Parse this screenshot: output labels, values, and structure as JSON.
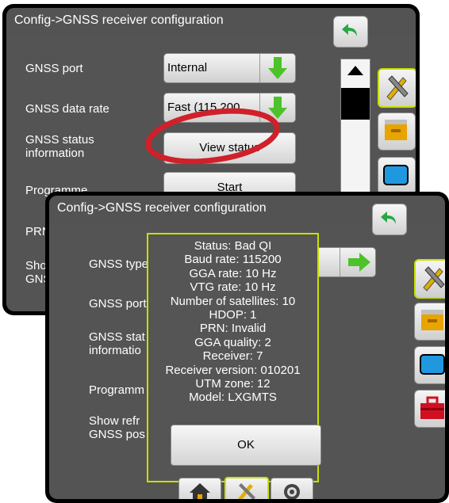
{
  "back_screen": {
    "title": "Config->GNSS receiver configuration",
    "rows": [
      {
        "label": "GNSS port",
        "value": "Internal"
      },
      {
        "label": "GNSS data rate",
        "value": "Fast (115 200"
      },
      {
        "label": "GNSS status\ninformation",
        "button": "View status"
      },
      {
        "label": "Programme",
        "button": "Start"
      },
      {
        "label": "PRN"
      },
      {
        "label": "Show\nGNSS"
      }
    ]
  },
  "front_screen": {
    "title": "Config->GNSS receiver configuration",
    "rows": [
      {
        "label": "GNSS type"
      },
      {
        "label": "GNSS port"
      },
      {
        "label": "GNSS stat\ninformatio"
      },
      {
        "label": "Programm"
      },
      {
        "label": "Show refr\nGNSS pos"
      }
    ]
  },
  "status_popup": {
    "lines": [
      "Status: Bad QI",
      "Baud rate: 115200",
      "GGA rate: 10 Hz",
      "VTG rate: 10 Hz",
      "Number of satellites: 10",
      "HDOP: 1",
      "PRN: Invalid",
      "GGA quality: 2",
      "Receiver: 7",
      "Receiver version: 010201",
      "UTM zone: 12",
      "Model: LXGMTS"
    ],
    "ok_label": "OK"
  },
  "colors": {
    "accent": "#c8e000",
    "highlight_circle": "#d0202a",
    "screen_bg": "#545454"
  },
  "icons": {
    "back": "back-arrow-icon",
    "dropdown": "green-down-arrow-icon",
    "tools": "tools-icon",
    "console": "console-icon",
    "display": "display-icon",
    "toolbox": "toolbox-icon",
    "home": "home-icon",
    "settings": "gear-icon"
  }
}
